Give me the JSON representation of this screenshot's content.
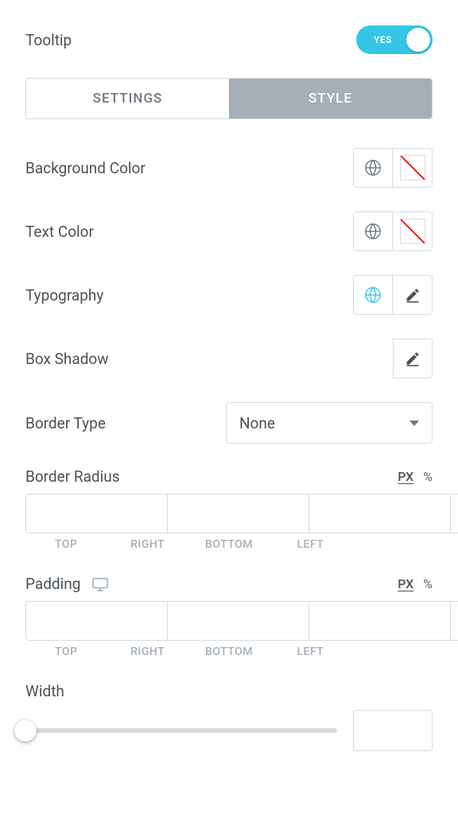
{
  "header": {
    "title": "Tooltip",
    "toggle_label": "YES"
  },
  "tabs": {
    "settings": "SETTINGS",
    "style": "STYLE"
  },
  "props": {
    "background_color": "Background Color",
    "text_color": "Text Color",
    "typography": "Typography",
    "box_shadow": "Box Shadow",
    "border_type": "Border Type",
    "border_type_value": "None",
    "border_radius": "Border Radius",
    "padding": "Padding",
    "width": "Width"
  },
  "units": {
    "px": "PX",
    "percent": "%"
  },
  "dims": {
    "top": "TOP",
    "right": "RIGHT",
    "bottom": "BOTTOM",
    "left": "LEFT"
  }
}
